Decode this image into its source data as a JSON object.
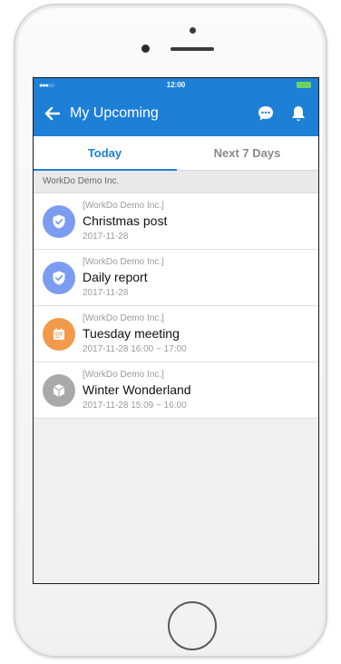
{
  "status": {
    "signal": "●●●○○",
    "time": "12:00"
  },
  "appbar": {
    "title": "My Upcoming"
  },
  "tabs": [
    {
      "label": "Today",
      "active": true
    },
    {
      "label": "Next 7 Days",
      "active": false
    }
  ],
  "section": {
    "label": "WorkDo Demo Inc."
  },
  "items": [
    {
      "org": "[WorkDo Demo Inc.]",
      "title": "Christmas post",
      "date": "2017-11-28",
      "icon": "shield-check-icon",
      "color": "#7b9cf0"
    },
    {
      "org": "[WorkDo Demo Inc.]",
      "title": "Daily report",
      "date": "2017-11-28",
      "icon": "shield-check-icon",
      "color": "#7b9cf0"
    },
    {
      "org": "[WorkDo Demo Inc.]",
      "title": "Tuesday meeting",
      "date": "2017-11-28 16:00 ~ 17:00",
      "icon": "calendar-icon",
      "color": "#f2994a"
    },
    {
      "org": "[WorkDo Demo Inc.]",
      "title": "Winter Wonderland",
      "date": "2017-11-28 15:09 ~ 16:00",
      "icon": "cube-icon",
      "color": "#a9a9a9"
    }
  ],
  "colors": {
    "accent": "#1e7fd6",
    "battery": "#6bd35b"
  }
}
